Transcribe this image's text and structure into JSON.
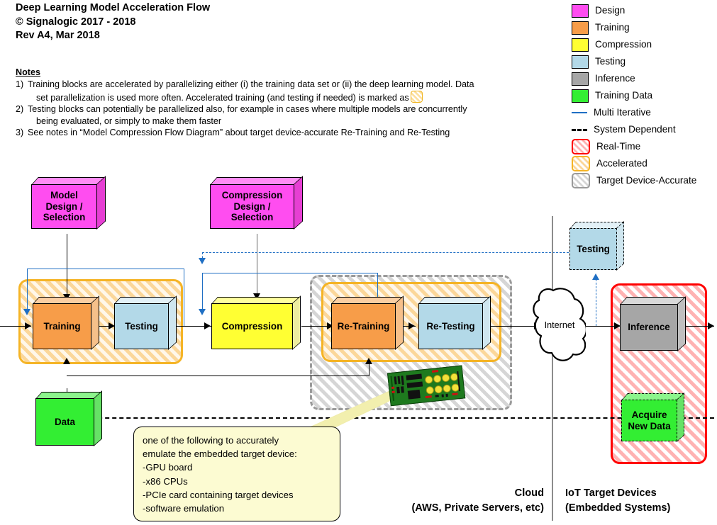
{
  "header": {
    "line1": "Deep Learning Model Acceleration Flow",
    "line2": "© Signalogic 2017 - 2018",
    "line3": "Rev A4, Mar 2018"
  },
  "notes": {
    "heading": "Notes",
    "items": [
      {
        "num": "1)",
        "part1": "Training blocks are accelerated by parallelizing either (i) the training data set or (ii) the deep learning model.  Data",
        "part2": "set parallelization is used more often.  Accelerated training (and testing if needed) is marked as",
        "has_swatch": true
      },
      {
        "num": "2)",
        "part1": "Testing blocks can potentially be parallelized also, for example in cases where multiple models are concurrently",
        "part2": "being evaluated, or simply to make them faster",
        "has_swatch": false
      },
      {
        "num": "3)",
        "part1": "See notes in “Model Compression Flow Diagram” about target device-accurate Re-Training and Re-Testing",
        "part2": "",
        "has_swatch": false
      }
    ]
  },
  "legend": {
    "items": [
      {
        "label": "Design",
        "kind": "swatch",
        "color": "#ff4df0"
      },
      {
        "label": "Training",
        "kind": "swatch",
        "color": "#f79d49"
      },
      {
        "label": "Compression",
        "kind": "swatch",
        "color": "#ffff33"
      },
      {
        "label": "Testing",
        "kind": "swatch",
        "color": "#b3d9e8"
      },
      {
        "label": "Inference",
        "kind": "swatch",
        "color": "#a6a6a6"
      },
      {
        "label": "Training Data",
        "kind": "swatch",
        "color": "#33ee33"
      },
      {
        "label": "Multi Iterative",
        "kind": "line",
        "color": "#1f6fc4",
        "style": "solid"
      },
      {
        "label": "System Dependent",
        "kind": "line",
        "color": "#000000",
        "style": "dashed"
      },
      {
        "label": "Real-Time",
        "kind": "hatch",
        "color": "#ff0000"
      },
      {
        "label": "Accelerated",
        "kind": "hatch",
        "color": "#f5b426"
      },
      {
        "label": "Target Device-Accurate",
        "kind": "hatch",
        "color": "#9a9a9a"
      }
    ]
  },
  "blocks": {
    "model_design": "Model\nDesign /\nSelection",
    "compression_design": "Compression\nDesign /\nSelection",
    "training": "Training",
    "testing": "Testing",
    "compression": "Compression",
    "re_training": "Re-Training",
    "re_testing": "Re-Testing",
    "data": "Data",
    "cloud_testing": "Testing",
    "inference": "Inference",
    "acquire": "Acquire\nNew Data",
    "internet": "Internet"
  },
  "callout": {
    "lines": [
      "one of the following to accurately",
      "emulate the embedded target device:",
      " -GPU board",
      " -x86 CPUs",
      " -PCIe card containing target devices",
      " -software emulation"
    ]
  },
  "footer": {
    "cloud_line1": "Cloud",
    "cloud_line2": "(AWS, Private Servers, etc)",
    "iot_line1": "IoT Target Devices",
    "iot_line2": "(Embedded Systems)"
  },
  "colors": {
    "design": "#ff4df0",
    "training": "#f79d49",
    "compression": "#ffff33",
    "testing": "#b3d9e8",
    "inference": "#a6a6a6",
    "data": "#33ee33",
    "multi_iterative": "#1f6fc4",
    "real_time": "#ff0000",
    "accelerated": "#f5b426",
    "target_device": "#9a9a9a"
  }
}
